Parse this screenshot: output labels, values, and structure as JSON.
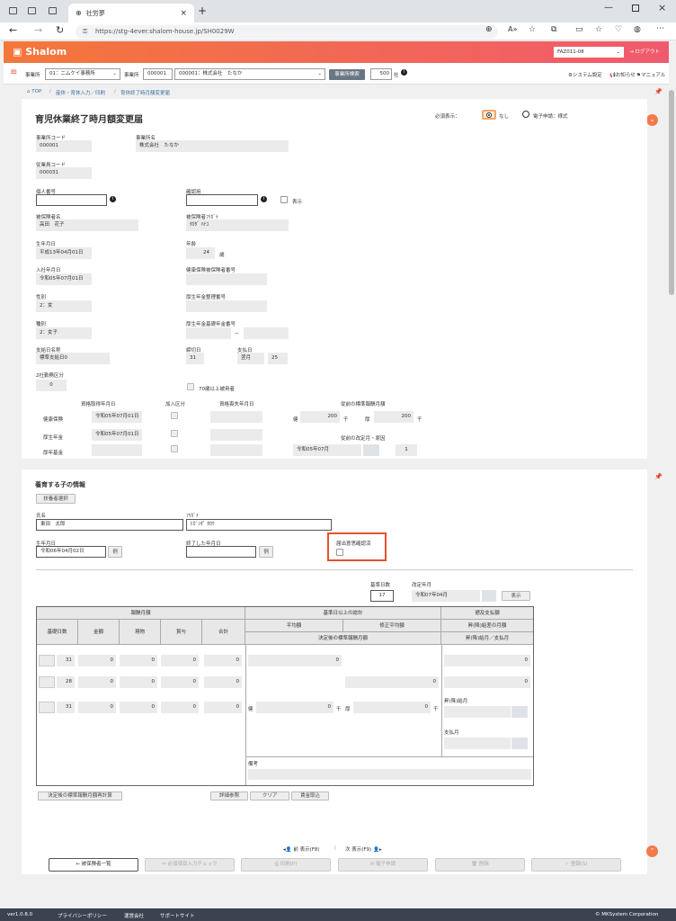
{
  "browser": {
    "tab_title": "社労夢",
    "url": "https://stg-4ever.shalom-house.jp/SH0029W"
  },
  "app": {
    "logo": "Shalom",
    "user_select": "FAZ011-08",
    "logout": "ログアウト"
  },
  "toolbar": {
    "office_label": "事業所",
    "office_select": "01：ニムケイ事務所",
    "employer_label": "事業所",
    "employer_code": "000001",
    "employer_select": "000001：株式会社　たなか",
    "search_button": "事業所検索",
    "count": "500",
    "count_unit": "社",
    "system_settings": "システム設定",
    "news": "お知らせ",
    "manual": "マニュアル"
  },
  "breadcrumb": {
    "top": "TOP",
    "level1": "産休・育休入力／印刷",
    "level2": "育休終了時月額変更届"
  },
  "form": {
    "title": "育児休業終了時月額変更届",
    "required_display_label": "必須表示：",
    "radio_none": "なし",
    "radio_electronic": "電子申請：様式",
    "office_code_label": "事業所コード",
    "office_code": "000001",
    "office_name_label": "事業所名",
    "office_name": "株式会社　たなか",
    "employee_code_label": "従業員コード",
    "employee_code": "000031",
    "personal_number_label": "個人番号",
    "confirm_label": "確認用",
    "show_label": "表示",
    "insured_name_label": "被保険者名",
    "insured_name": "高田　花子",
    "insured_kana_label": "被保険者ﾌﾘｶﾞﾅ",
    "insured_kana": "ﾀｶﾀﾞ ﾊﾅｺ",
    "birth_label": "生年月日",
    "birth": "平成13年04月01日",
    "age_label": "年齢",
    "age": "24",
    "age_unit": "歳",
    "hire_label": "入社年月日",
    "hire": "令和05年07月01日",
    "health_number_label": "健康保険被保険者番号",
    "gender_label": "性別",
    "gender": "2：女",
    "pension_number_label": "厚生年金整理番号",
    "category_label": "種別",
    "category": "2：女子",
    "basic_pension_label": "厚生年金基礎年金番号",
    "basic_dash": "−",
    "pay_name_label": "支給日名称",
    "pay_name": "標準支給日0",
    "close_day_label": "締切日",
    "close_day": "31",
    "pay_day_label": "支払日",
    "pay_month": "翌月",
    "pay_day": "25",
    "two_office_label": "2社勤務区分",
    "two_office": "0",
    "over70_label": "70歳以上被用者",
    "qual_date_header": "資格取得年月日",
    "join_header": "加入区分",
    "loss_date_header": "資格喪失年月日",
    "prev_std_header": "従前の標準報酬月額",
    "health_label": "健康保険",
    "health_date": "令和05年07月01日",
    "pension_label": "厚生年金",
    "pension_date": "令和05年07月01日",
    "fund_label": "厚年基金",
    "health_prefix": "健",
    "health_amount": "200",
    "thousand": "千",
    "pension_prefix": "厚",
    "pension_amount": "200",
    "prev_revision_label": "従前の改定月・原因",
    "prev_revision_month": "令和05年07月",
    "prev_revision_cause": "1"
  },
  "child": {
    "section_title": "養育する子の情報",
    "dependent_button": "扶養者選択",
    "name_label": "氏名",
    "name": "東田　太郎",
    "kana_label": "ﾌﾘｶﾞﾅ",
    "kana": "ﾋｶﾞｼﾀﾞ ﾀﾛｳ",
    "birth_label": "生年月日",
    "birth": "令和06年04月02日",
    "calendar": "例",
    "end_label": "終了した年月日",
    "end_calendar": "例",
    "sub_confirm_label": "届出意思確認済"
  },
  "calc": {
    "base_days_label": "基準日数",
    "base_days": "17",
    "revision_label": "改定年月",
    "revision": "令和07年04月",
    "show_button": "表示"
  },
  "grid": {
    "h_pay": "報酬月額",
    "h_over17": "基準日以上の総計",
    "h_retro": "遡及支払額",
    "h_days": "基礎日数",
    "h_amount": "金額",
    "h_goods": "現物",
    "h_bonus": "賞与",
    "h_total": "合計",
    "h_avg": "平均額",
    "h_mod_avg": "修正平均額",
    "h_prev_month": "昇(降)給差の月額",
    "h_decided": "決定後の標準報酬月額",
    "h_prev_retro": "昇(降)給月／支払月",
    "rows": [
      {
        "days": "31",
        "amount": "0",
        "goods": "0",
        "bonus": "0",
        "total": "0"
      },
      {
        "days": "28",
        "amount": "0",
        "goods": "0",
        "bonus": "0",
        "total": "0"
      },
      {
        "days": "31",
        "amount": "0",
        "goods": "0",
        "bonus": "0",
        "total": "0"
      }
    ],
    "avg": "0",
    "mod_avg": "0",
    "retro1": "0",
    "retro2": "0",
    "dec_health_prefix": "健",
    "dec_health": "0",
    "dec_thousand": "千",
    "dec_pension_prefix": "厚",
    "dec_pension": "0",
    "dec_thousand2": "千",
    "raise_month_label": "昇(降)給月",
    "pay_month_label": "支払月",
    "notes_label": "備考"
  },
  "actions": {
    "calc_button": "決定後の標準報酬月額再計算",
    "detail_button": "詳細参照",
    "clear_button": "クリア",
    "salary_button": "賃金取込",
    "prev": "前 表示(F8)",
    "next": "次 表示(F9)",
    "list_button": "被保険者一覧",
    "check_button": "必須項目入力チェック",
    "print_button": "印刷(P)",
    "e_button": "電子申請",
    "delete_button": "削除",
    "register_button": "登録(S)"
  },
  "footer": {
    "version": "ver1.0.8.0",
    "privacy": "プライバシーポリシー",
    "company": "運営会社",
    "support": "サポートサイト",
    "copyright": "© MKSystem Corporation"
  },
  "colors": {
    "accent": "#f05a3c",
    "header_start": "#f4773a",
    "header_end": "#f05a6e",
    "link": "#3a6ea5"
  }
}
